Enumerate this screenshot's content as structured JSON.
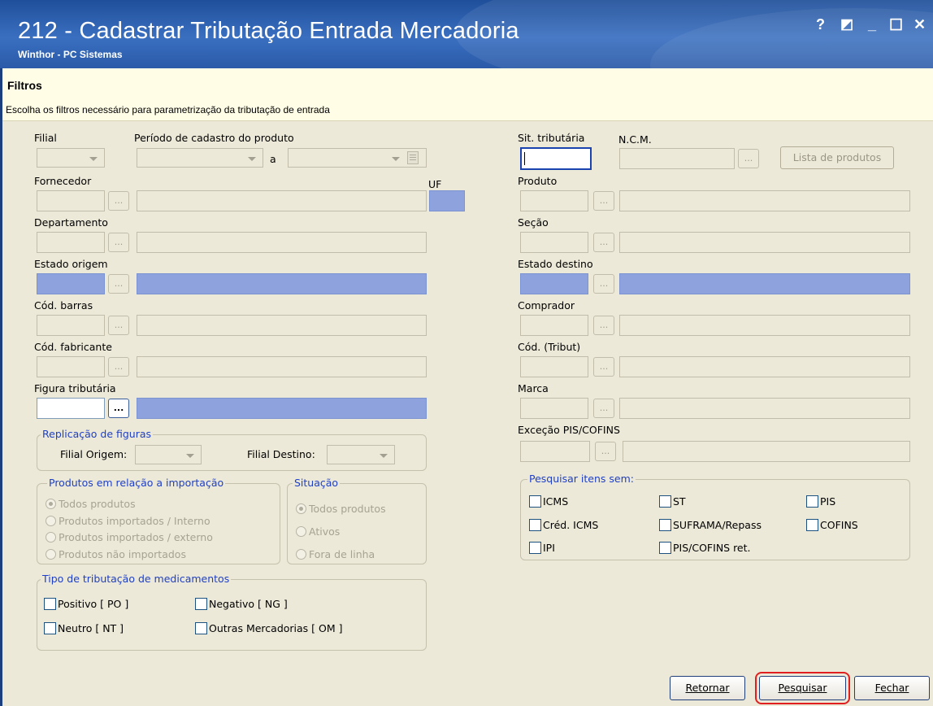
{
  "window": {
    "title": "212 - Cadastrar Tributação Entrada Mercadoria",
    "subtitle": "Winthor - PC Sistemas",
    "controls": {
      "help": "?",
      "restore": "◩",
      "minimize": "_",
      "maximize": "☐",
      "close": "✕"
    }
  },
  "banner": {
    "title": "Filtros",
    "description": "Escolha os filtros necessário para parametrização da tributação de entrada"
  },
  "left": {
    "filial": "Filial",
    "periodo": "Período de cadastro do produto",
    "periodo_sep": "a",
    "fornecedor": "Fornecedor",
    "uf": "UF",
    "departamento": "Departamento",
    "estado_origem": "Estado origem",
    "cod_barras": "Cód. barras",
    "cod_fabricante": "Cód. fabricante",
    "figura_tributaria": "Figura tributária"
  },
  "right": {
    "sit_tributaria": "Sit. tributária",
    "ncm": "N.C.M.",
    "lista_produtos": "Lista de produtos",
    "produto": "Produto",
    "secao": "Seção",
    "estado_destino": "Estado destino",
    "comprador": "Comprador",
    "cod_tribut": "Cód. (Tribut)",
    "marca": "Marca",
    "excecao": "Exceção PIS/COFINS"
  },
  "ellipsis": "...",
  "replicacao": {
    "title": "Replicação de figuras",
    "filial_origem": "Filial Origem:",
    "filial_destino": "Filial Destino:"
  },
  "importacao": {
    "title": "Produtos em relação a importação",
    "options": [
      "Todos produtos",
      "Produtos importados / Interno",
      "Produtos importados / externo",
      "Produtos não importados"
    ]
  },
  "situacao": {
    "title": "Situação",
    "options": [
      "Todos produtos",
      "Ativos",
      "Fora de linha"
    ]
  },
  "medicamentos": {
    "title": "Tipo de tributação de medicamentos",
    "options": [
      "Positivo [ PO ]",
      "Negativo [ NG ]",
      "Neutro [ NT ]",
      "Outras Mercadorias [ OM ]"
    ]
  },
  "pesquisar_sem": {
    "title": "Pesquisar itens sem:",
    "options": [
      "ICMS",
      "ST",
      "PIS",
      "Créd. ICMS",
      "SUFRAMA/Repass",
      "COFINS",
      "IPI",
      "PIS/COFINS ret."
    ]
  },
  "buttons": {
    "retornar": "Retornar",
    "pesquisar": "Pesquisar",
    "fechar": "Fechar"
  },
  "colors": {
    "titlebar": "#2a5aa8",
    "selected_field": "#8ea3dd",
    "group_title": "#1e3fc8",
    "highlight": "#e02020"
  }
}
